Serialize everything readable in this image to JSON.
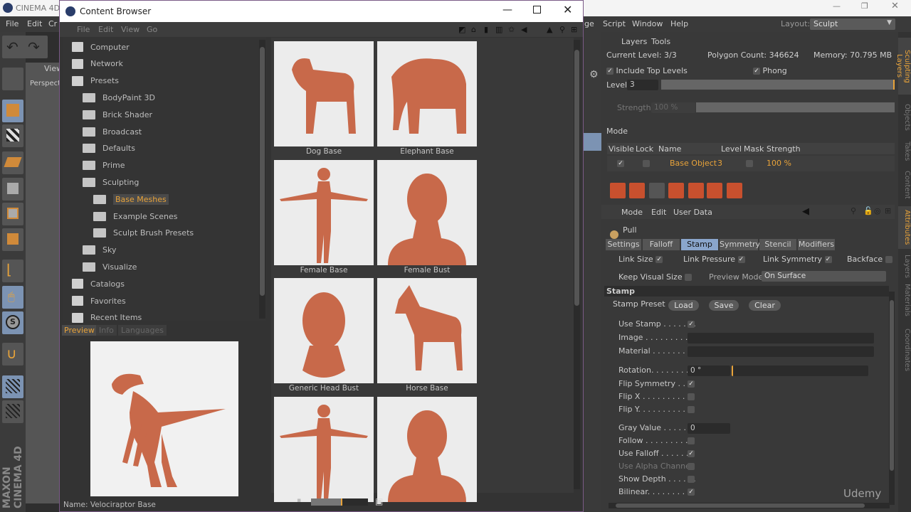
{
  "app": {
    "title": "CINEMA 4D",
    "menu": [
      "File",
      "Edit",
      "Cr"
    ],
    "right_menu": [
      "ge",
      "Script",
      "Window",
      "Help"
    ],
    "layout_label": "Layout:",
    "layout_value": "Sculpt",
    "brand": "MAXON CINEMA 4D",
    "viewport_menu": "View",
    "viewport_name": "Perspect"
  },
  "content_browser": {
    "title": "Content Browser",
    "menu": [
      "File",
      "Edit",
      "View",
      "Go"
    ],
    "tree": [
      {
        "label": "Computer",
        "level": 0,
        "icon": "computer-icon"
      },
      {
        "label": "Network",
        "level": 0,
        "icon": "network-icon"
      },
      {
        "label": "Presets",
        "level": 0,
        "icon": "presets-icon"
      },
      {
        "label": "BodyPaint 3D",
        "level": 1,
        "icon": "folder-icon"
      },
      {
        "label": "Brick Shader",
        "level": 1,
        "icon": "folder-icon"
      },
      {
        "label": "Broadcast",
        "level": 1,
        "icon": "folder-icon"
      },
      {
        "label": "Defaults",
        "level": 1,
        "icon": "folder-icon"
      },
      {
        "label": "Prime",
        "level": 1,
        "icon": "folder-icon"
      },
      {
        "label": "Sculpting",
        "level": 1,
        "icon": "folder-open-icon"
      },
      {
        "label": "Base Meshes",
        "level": 2,
        "icon": "folder-icon",
        "selected": true
      },
      {
        "label": "Example Scenes",
        "level": 2,
        "icon": "folder-icon"
      },
      {
        "label": "Sculpt Brush Presets",
        "level": 2,
        "icon": "folder-icon"
      },
      {
        "label": "Sky",
        "level": 1,
        "icon": "folder-icon"
      },
      {
        "label": "Visualize",
        "level": 1,
        "icon": "folder-icon"
      },
      {
        "label": "Catalogs",
        "level": 0,
        "icon": "catalog-icon"
      },
      {
        "label": "Favorites",
        "level": 0,
        "icon": "star-icon"
      },
      {
        "label": "Recent Items",
        "level": 0,
        "icon": "recent-icon"
      }
    ],
    "preview_tabs": [
      "Preview",
      "Info",
      "Languages"
    ],
    "preview_name": "Name: Velociraptor Base",
    "items": [
      {
        "label": "Dog Base",
        "shape": "dog"
      },
      {
        "label": "Elephant Base",
        "shape": "elephant"
      },
      {
        "label": "Female Base",
        "shape": "tpose"
      },
      {
        "label": "Female Bust",
        "shape": "bust"
      },
      {
        "label": "Generic Head Bust",
        "shape": "head"
      },
      {
        "label": "Horse Base",
        "shape": "horse"
      },
      {
        "label": "",
        "shape": "tpose"
      },
      {
        "label": "",
        "shape": "bust"
      }
    ]
  },
  "sculpt_layers": {
    "tabs": [
      "Layers",
      "Tools"
    ],
    "current_level": "Current Level: 3/3",
    "polygon_count": "Polygon Count: 346624",
    "memory": "Memory: 70.795 MB",
    "include_top_levels": "Include Top Levels",
    "phong": "Phong",
    "level_label": "Level",
    "level_value": "3",
    "strength_label": "Strength",
    "strength_value": "100 %",
    "mode": "Mode",
    "columns": [
      "Visible",
      "Lock",
      "Name",
      "Level",
      "Mask",
      "Strength"
    ],
    "row": {
      "name": "Base Object",
      "level": "3",
      "strength": "100 %"
    }
  },
  "attributes": {
    "menu": [
      "Mode",
      "Edit",
      "User Data"
    ],
    "tool": "Pull",
    "tabs": [
      "Settings",
      "Falloff",
      "Stamp",
      "Symmetry",
      "Stencil",
      "Modifiers"
    ],
    "active_tab": "Stamp",
    "link_size": "Link Size",
    "link_pressure": "Link Pressure",
    "link_symmetry": "Link Symmetry",
    "backface": "Backface",
    "keep_visual_size": "Keep Visual Size",
    "preview_mode": "Preview Mode",
    "preview_mode_value": "On Surface",
    "section": "Stamp",
    "stamp_preset": "Stamp Preset",
    "load": "Load",
    "save": "Save",
    "clear": "Clear",
    "props": [
      {
        "label": "Use Stamp . . . . . . .",
        "checked": true
      },
      {
        "label": "Image . . . . . . . . . ."
      },
      {
        "label": "Material . . . . . . . ."
      },
      {
        "label": "Rotation. . . . . . . .",
        "value": "0 °"
      },
      {
        "label": "Flip Symmetry . . . .",
        "checked": true
      },
      {
        "label": "Flip X . . . . . . . . . .",
        "checked": false
      },
      {
        "label": "Flip Y. . . . . . . . . .",
        "checked": false
      },
      {
        "label": "Gray Value . . . . . . .",
        "value": "0"
      },
      {
        "label": "Follow . . . . . . . . . .",
        "checked": false
      },
      {
        "label": "Use Falloff . . . . . . .",
        "checked": true
      },
      {
        "label": "Use Alpha Channel",
        "checked": false
      },
      {
        "label": "Show Depth . . . . . .",
        "checked": false
      },
      {
        "label": "Bilinear. . . . . . . . .",
        "checked": true
      }
    ]
  },
  "side_tabs": [
    "Sculpting Layers",
    "Objects",
    "Takes",
    "Content",
    "Attributes",
    "Layers",
    "Materials",
    "Coordinates"
  ],
  "watermark": "Udemy",
  "colors": {
    "accent": "#e8a33a",
    "selected_tab": "#8aa6cc",
    "model": "#c8694a"
  }
}
